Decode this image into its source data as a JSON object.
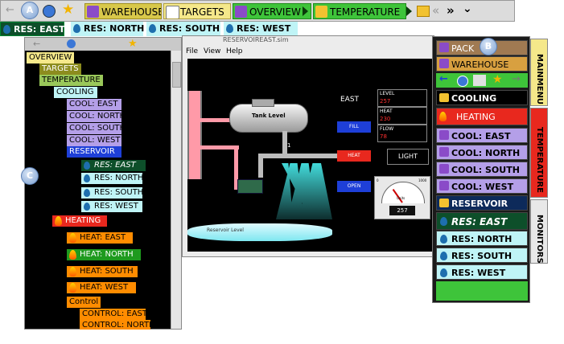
{
  "callouts": {
    "a": "A",
    "b": "B",
    "c": "C"
  },
  "toolbar": {
    "warehouse": "WAREHOUSE",
    "targets": "TARGETS",
    "overview": "OVERVIEW",
    "temperature": "TEMPERATURE",
    "nav_back": "«",
    "nav_forward": "»",
    "dropdown": "⌄"
  },
  "res_bar": [
    "RES: EAST",
    "RES: NORTH",
    "RES: SOUTH",
    "RES: WEST"
  ],
  "tree": {
    "overview": "OVERVIEW",
    "targets": "TARGETS",
    "temperature": "TEMPERATURE",
    "cooling": "COOLING",
    "cool_east": "COOL: EAST",
    "cool_north": "COOL: NORTH",
    "cool_south": "COOL: SOUTH",
    "cool_west": "COOL: WEST",
    "reservoir": "RESERVOIR",
    "res_east": "RES: EAST",
    "res_north": "RES: NORTH",
    "res_south": "RES: SOUTH",
    "res_west": "RES: WEST",
    "heating": "HEATING",
    "heat_east": "HEAT: EAST",
    "heat_north": "HEAT: NORTH",
    "heat_south": "HEAT: SOUTH",
    "heat_west": "HEAT: WEST",
    "control": "Control",
    "control_east": "CONTROL: EAST",
    "control_north": "CONTROL: NORTH"
  },
  "scada": {
    "title": "RESERVOIREAST.sim",
    "menu": [
      "File",
      "View",
      "Help"
    ],
    "tank_label": "Tank Level",
    "reservoir_label": "Reservoir Level",
    "pump_label": "1",
    "region": "EAST",
    "level_label": "LEVEL",
    "level_value": "257",
    "heat_label": "HEAT",
    "heat_value": "230",
    "flow_label": "FLOW",
    "flow_value": "78",
    "fill_button": "FILL",
    "heat_button": "HEAT",
    "open_button": "OPEN",
    "light_label": "LIGHT",
    "gauge_ticks": [
      "0",
      "250",
      "500",
      "750",
      "1000"
    ],
    "gauge_unit": "Units",
    "gauge_readout": "257"
  },
  "right_menu": {
    "pack": "PACK",
    "warehouse": "WAREHOUSE",
    "cooling": "COOLING",
    "heating": "HEATING",
    "cool_east": "COOL: EAST",
    "cool_north": "COOL: NORTH",
    "cool_south": "COOL: SOUTH",
    "cool_west": "COOL: WEST",
    "reservoir": "RESERVOIR",
    "res_east": "RES: EAST",
    "res_north": "RES: NORTH",
    "res_south": "RES: SOUTH",
    "res_west": "RES: WEST"
  },
  "side_tabs": [
    "MAINMENU",
    "TEMPERATURE",
    "MONITORS"
  ],
  "colors": {
    "lavender": "#b49fe8",
    "cyan": "#bff4f6",
    "green": "#3ec43a",
    "orange": "#ff8c00",
    "red": "#e8281e",
    "blue": "#1e3fd8",
    "olive": "#8c8c1e",
    "yellow": "#f5e88a"
  }
}
